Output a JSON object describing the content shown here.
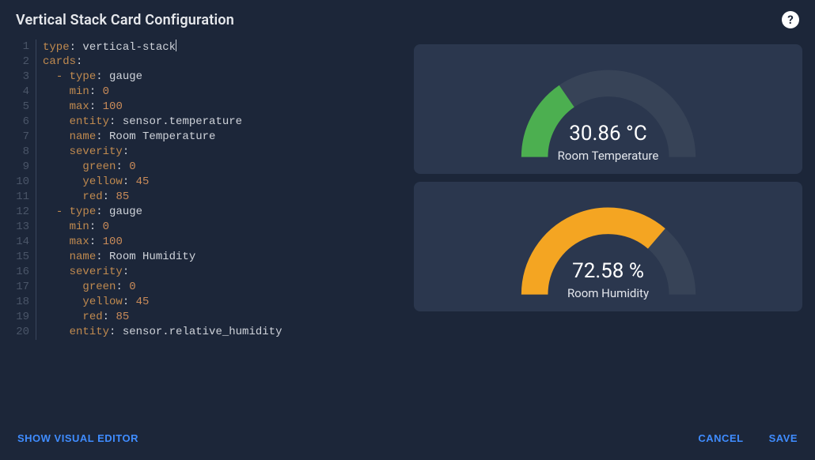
{
  "header": {
    "title": "Vertical Stack Card Configuration",
    "help_label": "?"
  },
  "editor": {
    "lines": [
      {
        "n": 1,
        "tokens": [
          {
            "t": "key",
            "v": "type"
          },
          {
            "t": "word",
            "v": ": vertical-stack"
          }
        ],
        "hl": true,
        "cursor": true
      },
      {
        "n": 2,
        "tokens": [
          {
            "t": "key",
            "v": "cards"
          },
          {
            "t": "word",
            "v": ":"
          }
        ]
      },
      {
        "n": 3,
        "tokens": [
          {
            "t": "word",
            "v": "  "
          },
          {
            "t": "ind",
            "v": "- "
          },
          {
            "t": "key",
            "v": "type"
          },
          {
            "t": "word",
            "v": ": gauge"
          }
        ]
      },
      {
        "n": 4,
        "tokens": [
          {
            "t": "word",
            "v": "    "
          },
          {
            "t": "key",
            "v": "min"
          },
          {
            "t": "word",
            "v": ": "
          },
          {
            "t": "num",
            "v": "0"
          }
        ]
      },
      {
        "n": 5,
        "tokens": [
          {
            "t": "word",
            "v": "    "
          },
          {
            "t": "key",
            "v": "max"
          },
          {
            "t": "word",
            "v": ": "
          },
          {
            "t": "num",
            "v": "100"
          }
        ]
      },
      {
        "n": 6,
        "tokens": [
          {
            "t": "word",
            "v": "    "
          },
          {
            "t": "key",
            "v": "entity"
          },
          {
            "t": "word",
            "v": ": sensor.temperature"
          }
        ]
      },
      {
        "n": 7,
        "tokens": [
          {
            "t": "word",
            "v": "    "
          },
          {
            "t": "key",
            "v": "name"
          },
          {
            "t": "word",
            "v": ": Room Temperature"
          }
        ]
      },
      {
        "n": 8,
        "tokens": [
          {
            "t": "word",
            "v": "    "
          },
          {
            "t": "key",
            "v": "severity"
          },
          {
            "t": "word",
            "v": ":"
          }
        ]
      },
      {
        "n": 9,
        "tokens": [
          {
            "t": "word",
            "v": "      "
          },
          {
            "t": "key",
            "v": "green"
          },
          {
            "t": "word",
            "v": ": "
          },
          {
            "t": "num",
            "v": "0"
          }
        ]
      },
      {
        "n": 10,
        "tokens": [
          {
            "t": "word",
            "v": "      "
          },
          {
            "t": "key",
            "v": "yellow"
          },
          {
            "t": "word",
            "v": ": "
          },
          {
            "t": "num",
            "v": "45"
          }
        ]
      },
      {
        "n": 11,
        "tokens": [
          {
            "t": "word",
            "v": "      "
          },
          {
            "t": "key",
            "v": "red"
          },
          {
            "t": "word",
            "v": ": "
          },
          {
            "t": "num",
            "v": "85"
          }
        ]
      },
      {
        "n": 12,
        "tokens": [
          {
            "t": "word",
            "v": "  "
          },
          {
            "t": "ind",
            "v": "- "
          },
          {
            "t": "key",
            "v": "type"
          },
          {
            "t": "word",
            "v": ": gauge"
          }
        ]
      },
      {
        "n": 13,
        "tokens": [
          {
            "t": "word",
            "v": "    "
          },
          {
            "t": "key",
            "v": "min"
          },
          {
            "t": "word",
            "v": ": "
          },
          {
            "t": "num",
            "v": "0"
          }
        ]
      },
      {
        "n": 14,
        "tokens": [
          {
            "t": "word",
            "v": "    "
          },
          {
            "t": "key",
            "v": "max"
          },
          {
            "t": "word",
            "v": ": "
          },
          {
            "t": "num",
            "v": "100"
          }
        ]
      },
      {
        "n": 15,
        "tokens": [
          {
            "t": "word",
            "v": "    "
          },
          {
            "t": "key",
            "v": "name"
          },
          {
            "t": "word",
            "v": ": Room Humidity"
          }
        ]
      },
      {
        "n": 16,
        "tokens": [
          {
            "t": "word",
            "v": "    "
          },
          {
            "t": "key",
            "v": "severity"
          },
          {
            "t": "word",
            "v": ":"
          }
        ]
      },
      {
        "n": 17,
        "tokens": [
          {
            "t": "word",
            "v": "      "
          },
          {
            "t": "key",
            "v": "green"
          },
          {
            "t": "word",
            "v": ": "
          },
          {
            "t": "num",
            "v": "0"
          }
        ]
      },
      {
        "n": 18,
        "tokens": [
          {
            "t": "word",
            "v": "      "
          },
          {
            "t": "key",
            "v": "yellow"
          },
          {
            "t": "word",
            "v": ": "
          },
          {
            "t": "num",
            "v": "45"
          }
        ]
      },
      {
        "n": 19,
        "tokens": [
          {
            "t": "word",
            "v": "      "
          },
          {
            "t": "key",
            "v": "red"
          },
          {
            "t": "word",
            "v": ": "
          },
          {
            "t": "num",
            "v": "85"
          }
        ]
      },
      {
        "n": 20,
        "tokens": [
          {
            "t": "word",
            "v": "    "
          },
          {
            "t": "key",
            "v": "entity"
          },
          {
            "t": "word",
            "v": ": sensor.relative_humidity"
          }
        ]
      }
    ]
  },
  "preview": {
    "cards": [
      {
        "name": "Room Temperature",
        "value_text": "30.86 °C",
        "value": 30.86,
        "unit": "°C",
        "min": 0,
        "max": 100,
        "severity": {
          "green": 0,
          "yellow": 45,
          "red": 85
        }
      },
      {
        "name": "Room Humidity",
        "value_text": "72.58 %",
        "value": 72.58,
        "unit": "%",
        "min": 0,
        "max": 100,
        "severity": {
          "green": 0,
          "yellow": 45,
          "red": 85
        }
      }
    ]
  },
  "colors": {
    "green": "#4caf50",
    "yellow": "#f4a522",
    "red": "#e53935",
    "empty": "#374357"
  },
  "footer": {
    "show_visual_editor": "Show Visual Editor",
    "cancel": "Cancel",
    "save": "Save"
  }
}
